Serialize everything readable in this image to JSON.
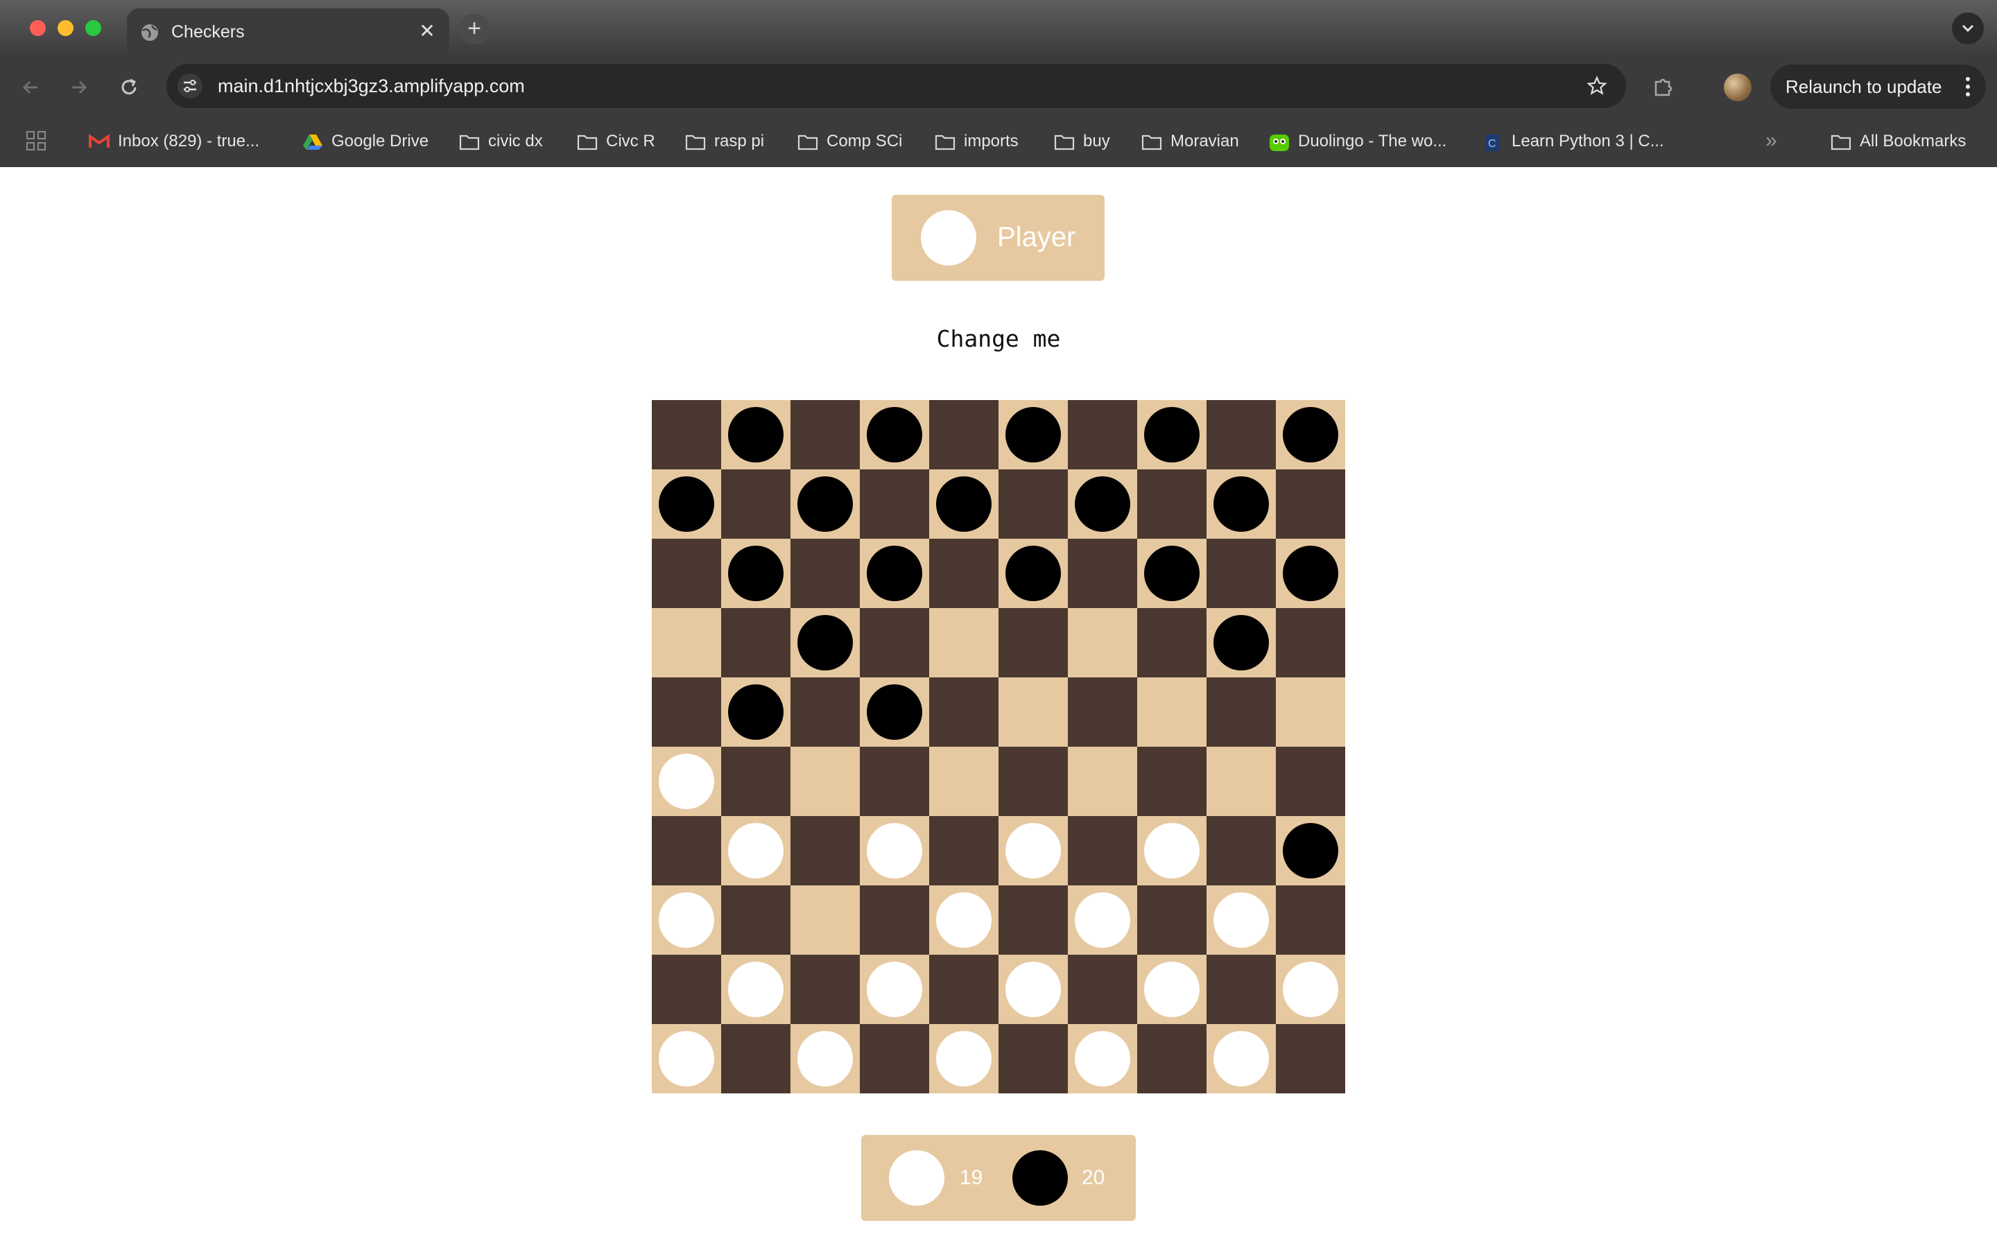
{
  "browser": {
    "tab_title": "Checkers",
    "url": "main.d1nhtjcxbj3gz3.amplifyapp.com",
    "relaunch_label": "Relaunch to update",
    "bookmarks": [
      {
        "label": "Inbox (829) - true...",
        "icon": "gmail-icon"
      },
      {
        "label": "Google Drive",
        "icon": "google-drive-icon"
      },
      {
        "label": "civic dx",
        "icon": "folder-icon"
      },
      {
        "label": "Civc R",
        "icon": "folder-icon"
      },
      {
        "label": "rasp pi",
        "icon": "folder-icon"
      },
      {
        "label": "Comp SCi",
        "icon": "folder-icon"
      },
      {
        "label": "imports",
        "icon": "folder-icon"
      },
      {
        "label": "buy",
        "icon": "folder-icon"
      },
      {
        "label": "Moravian",
        "icon": "folder-icon"
      },
      {
        "label": "Duolingo - The wo...",
        "icon": "duolingo-icon"
      },
      {
        "label": "Learn Python 3 | C...",
        "icon": "codecademy-icon"
      },
      {
        "label": "All Bookmarks",
        "icon": "folder-icon"
      }
    ]
  },
  "game": {
    "player_label": "Player",
    "player_color": "white",
    "status_text": "Change me",
    "score": {
      "white": "19",
      "black": "20"
    },
    "board": [
      ". B . B . B . B . B",
      "B . B . B . B . B .",
      ". B . B . B . B . B",
      ". . B . . . . . B .",
      ". B . B . . . . . .",
      "W . . . . . . . . .",
      ". W . W . W . W . B",
      "W . . . W . W . W .",
      ". W . W . W . W . W",
      "W . W . W . W . W ."
    ],
    "colors": {
      "light_square": "#e6c9a0",
      "dark_square": "#4a3830",
      "white_piece": "#ffffff",
      "black_piece": "#000000"
    }
  }
}
